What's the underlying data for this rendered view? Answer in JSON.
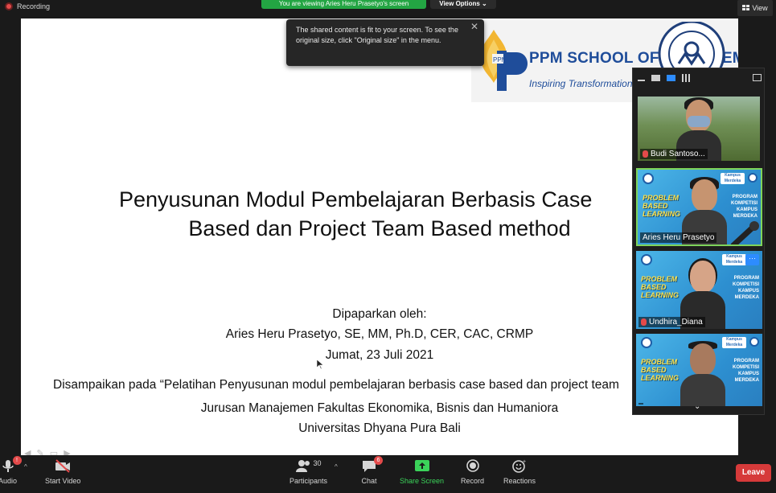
{
  "topbar": {
    "recording_label": "Recording",
    "viewing_banner": "You are viewing Aries Heru Prasetyo's screen",
    "view_options": "View Options ⌄",
    "view_button": "View"
  },
  "tooltip": {
    "message": "The shared content is fit to your screen. To see the original size, click \"Original size\" in the menu."
  },
  "slide": {
    "logo_line1": "PPM SCHOOL OF MANAGEMENT",
    "logo_line2": "Inspiring Transformation",
    "title_line1": "Penyusunan Modul Pembelajaran Berbasis Case",
    "title_line2": "Based dan Project Team Based method",
    "presenter_label": "Dipaparkan oleh:",
    "presenter_name": "Aries Heru Prasetyo, SE, MM, Ph.D, CER, CAC, CRMP",
    "date": "Jumat, 23 Juli 2021",
    "delivered_at": "Disampaikan pada “Pelatihan Penyusunan modul pembelajaran berbasis case based dan project team",
    "department": "Jurusan Manajemen Fakultas Ekonomika, Bisnis dan Humaniora",
    "university": "Universitas Dhyana Pura Bali"
  },
  "gallery": {
    "tiles": [
      {
        "name": "Budi Santoso..."
      },
      {
        "name": "Aries Heru Prasetyo"
      },
      {
        "name": "Undhira_Diana"
      },
      {
        "name": ""
      }
    ],
    "background": {
      "wordmark": "PROBLEM BASED LEARNING",
      "program": "PROGRAM KOMPETISI KAMPUS MERDEKA",
      "badge": "Kampus Merdeka"
    }
  },
  "toolbar": {
    "audio": "Audio",
    "start_video": "Start Video",
    "participants": "Participants",
    "participants_count": "30",
    "chat": "Chat",
    "chat_badge": "6",
    "share_screen": "Share Screen",
    "record": "Record",
    "reactions": "Reactions",
    "leave": "Leave",
    "audio_badge": "!"
  },
  "colors": {
    "share_green": "#23a543",
    "leave_red": "#d63a3a",
    "active_blue": "#2d8cff",
    "speaker_border": "#7fd45a"
  }
}
